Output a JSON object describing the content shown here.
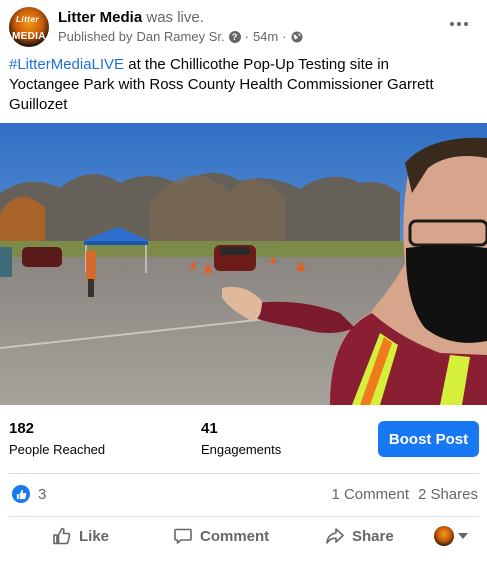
{
  "post": {
    "page_name": "Litter Media",
    "action_text": "was live.",
    "publisher_prefix": "Published by",
    "publisher_name": "Dan Ramey Sr.",
    "time": "54m",
    "avatar_logo_top": "Litter",
    "avatar_logo_bottom": "MEDIA",
    "hashtag": "#LitterMediaLIVE",
    "caption_line1_rest": " at the Chillicothe Pop-Up Testing site in",
    "caption_line2": "Yoctangee Park with Ross County Health Commissioner Garrett",
    "caption_line3": "Guillozet"
  },
  "stats": {
    "reached_value": "182",
    "reached_label": "People Reached",
    "engagements_value": "41",
    "engagements_label": "Engagements",
    "boost_label": "Boost Post"
  },
  "reactions": {
    "like_count": "3",
    "comments": "1 Comment",
    "shares": "2 Shares"
  },
  "actions": {
    "like": "Like",
    "comment": "Comment",
    "share": "Share"
  },
  "icons": {
    "more": "more-dots-icon",
    "globe": "globe-icon",
    "like": "thumbs-up-icon",
    "comment": "comment-bubble-icon",
    "share": "share-arrow-icon"
  },
  "colors": {
    "accent": "#1877f2",
    "hashtag": "#216fdb",
    "secondary_text": "#65676b"
  }
}
